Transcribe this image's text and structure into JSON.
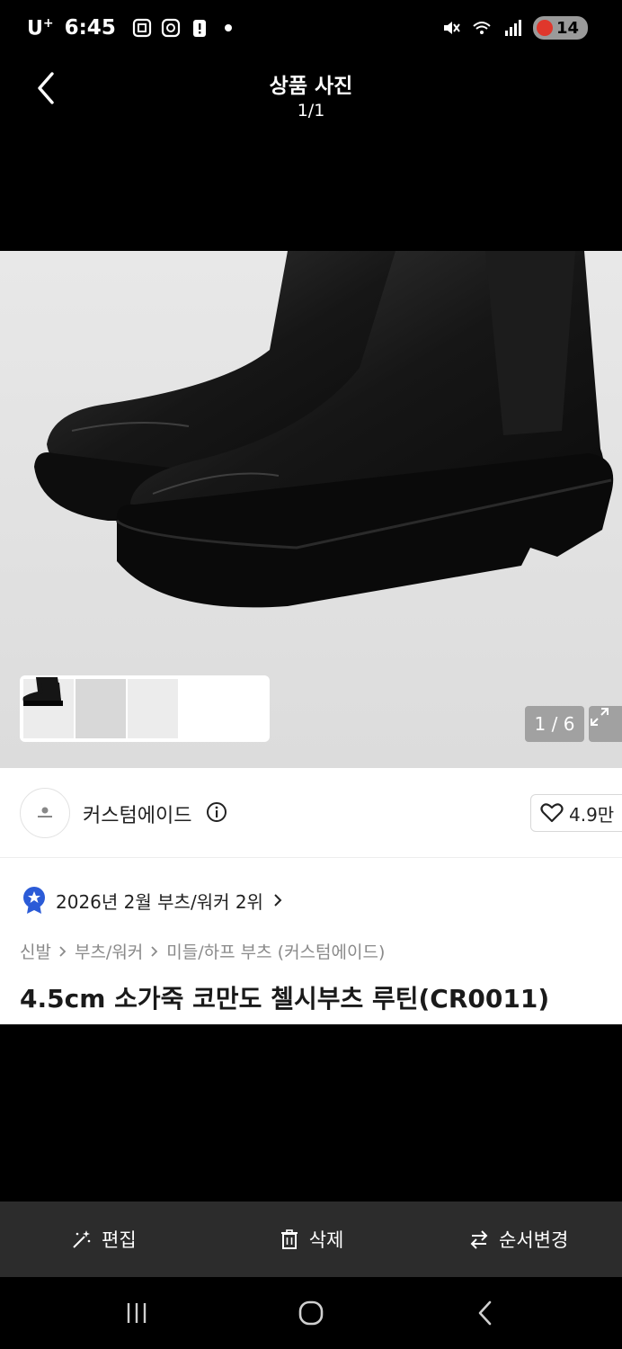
{
  "status_bar": {
    "carrier": "U",
    "carrier_sup": "+",
    "time": "6:45",
    "battery": "14",
    "icons": [
      "screenshot-icon",
      "instagram-icon",
      "alert-icon",
      "dot-icon",
      "mute-icon",
      "wifi-icon",
      "signal-icon"
    ]
  },
  "nav": {
    "title": "상품 사진",
    "counter": "1/1"
  },
  "gallery": {
    "counter": "1 / 6"
  },
  "seller": {
    "name": "커스텀에이드",
    "likes": "4.9만"
  },
  "product": {
    "rank": "2026년 2월 부츠/워커 2위",
    "breadcrumb": [
      "신발",
      "부츠/워커",
      "미들/하프 부츠 (커스텀에이드)"
    ],
    "title": "4.5cm 소가죽 코만도 첼시부츠 루틴(CR0011)"
  },
  "actions": {
    "edit": "편집",
    "delete": "삭제",
    "reorder": "순서변경"
  },
  "colors": {
    "accent_badge": "#2b5bd7",
    "action_bar": "#2c2c2c"
  }
}
